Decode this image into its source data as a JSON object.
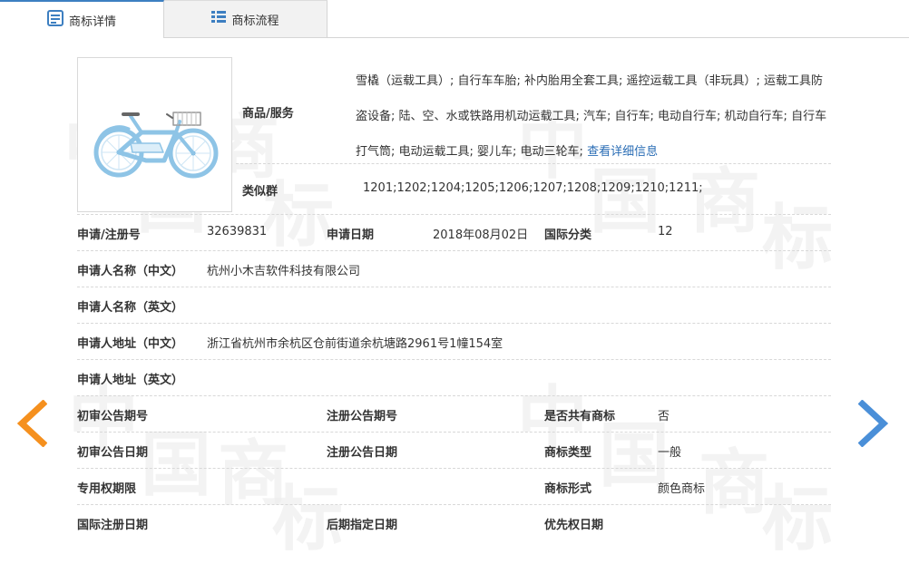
{
  "tabs": [
    {
      "label": "商标详情",
      "icon": "document-list-icon",
      "active": true
    },
    {
      "label": "商标流程",
      "icon": "grid-list-icon",
      "active": false
    }
  ],
  "watermark_char": [
    "中",
    "国",
    "商",
    "标"
  ],
  "goods": {
    "label": "商品/服务",
    "text": "雪橇（运载工具）; 自行车车胎; 补内胎用全套工具; 遥控运载工具（非玩具）; 运载工具防盗设备; 陆、空、水或铁路用机动运载工具; 汽车; 自行车; 电动自行车; 机动自行车; 自行车打气筒; 电动运载工具; 婴儿车; 电动三轮车;",
    "link": "查看详细信息"
  },
  "similar_group": {
    "label": "类似群",
    "value": "1201;1202;1204;1205;1206;1207;1208;1209;1210;1211;"
  },
  "fields": {
    "reg_no_label": "申请/注册号",
    "reg_no": "32639831",
    "apply_date_label": "申请日期",
    "apply_date": "2018年08月02日",
    "intl_class_label": "国际分类",
    "intl_class": "12",
    "applicant_cn_label": "申请人名称（中文）",
    "applicant_cn": "杭州小木吉软件科技有限公司",
    "applicant_en_label": "申请人名称（英文）",
    "applicant_en": "",
    "address_cn_label": "申请人地址（中文）",
    "address_cn": "浙江省杭州市余杭区仓前街道余杭塘路2961号1幢154室",
    "address_en_label": "申请人地址（英文）",
    "address_en": "",
    "prelim_pub_no_label": "初审公告期号",
    "prelim_pub_no": "",
    "reg_pub_no_label": "注册公告期号",
    "reg_pub_no": "",
    "shared_label": "是否共有商标",
    "shared": "否",
    "prelim_pub_date_label": "初审公告日期",
    "prelim_pub_date": "",
    "reg_pub_date_label": "注册公告日期",
    "reg_pub_date": "",
    "mark_type_label": "商标类型",
    "mark_type": "一般",
    "exclusive_period_label": "专用权期限",
    "exclusive_period": "",
    "mark_form_label": "商标形式",
    "mark_form": "颜色商标",
    "intl_reg_date_label": "国际注册日期",
    "intl_reg_date": "",
    "later_date_label": "后期指定日期",
    "later_date": "",
    "priority_date_label": "优先权日期",
    "priority_date": ""
  },
  "colors": {
    "accent": "#3d7fc1",
    "left_arrow": "#f5901e",
    "right_arrow": "#4a8fd8"
  },
  "nav": {
    "prev_icon": "chevron-left-icon",
    "next_icon": "chevron-right-icon"
  }
}
